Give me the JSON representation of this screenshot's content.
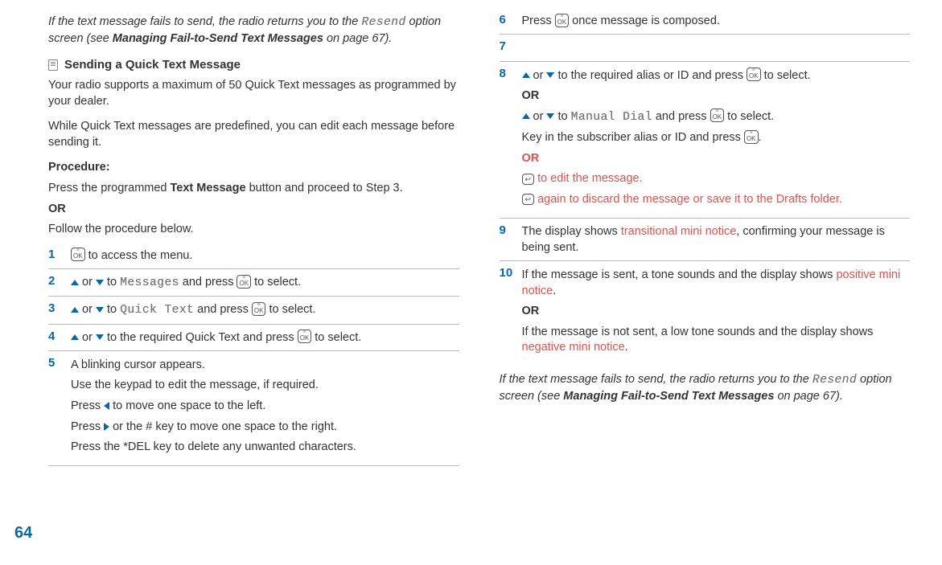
{
  "pageNumber": "64",
  "left": {
    "intro": {
      "pre": "If the text message fails to send, the radio returns you to the ",
      "mono": "Resend",
      "mid": " option screen (see ",
      "boldRef": "Managing Fail-to-Send Text Messages",
      "post": " on page 67)."
    },
    "heading": "Sending a Quick Text Message",
    "para1": "Your radio supports a maximum of 50 Quick Text messages as programmed by your dealer.",
    "para2": "While Quick Text messages are predefined, you can edit each message before sending it.",
    "procedureLabel": "Procedure:",
    "procLine1a": "Press the programmed ",
    "procLine1b": "Text Message",
    "procLine1c": " button and proceed to Step 3.",
    "or": "OR",
    "procLine2": "Follow the procedure below.",
    "steps": {
      "s1": " to access the menu.",
      "s2_or": " or ",
      "s2_to": " to ",
      "s2_menu": "Messages",
      "s2_and": " and press ",
      "s2_end": " to select.",
      "s3_menu": "Quick Text",
      "s4_txt": " to the required Quick Text and press ",
      "s5_l1": "A blinking cursor appears.",
      "s5_l2": "Use the keypad to edit the message, if required.",
      "s5_l3a": "Press ",
      "s5_l3b": " to move one space to the left.",
      "s5_l4a": "Press ",
      "s5_l4b": " or the # key to move one space to the right.",
      "s5_l5": "Press the *DEL key to delete any unwanted characters."
    }
  },
  "right": {
    "s6a": "Press ",
    "s6b": " once message is composed.",
    "s8": {
      "l1a": " or ",
      "l1b": " to the required alias or ID and press ",
      "l1c": " to select.",
      "or": "OR",
      "l2a": " or ",
      "l2b": " to ",
      "l2menu": "Manual Dial",
      "l2c": " and press ",
      "l2d": " to select.",
      "l3a": "Key in the subscriber alias or ID and press ",
      "l3b": ".",
      "or2": "OR",
      "red1": " to edit the message.",
      "red2": " again to discard the message or save it to the Drafts folder."
    },
    "s9a": "The display shows ",
    "s9red": "transitional mini notice",
    "s9b": ", confirming your message is being sent.",
    "s10a": "If the message is sent, a tone sounds and the display shows ",
    "s10red1": "positive mini notice",
    "s10b": ".",
    "s10or": "OR",
    "s10c": "If the message is not sent, a low tone sounds and the display shows ",
    "s10red2": "negative mini notice",
    "s10d": ".",
    "outro": {
      "pre": "If the text message fails to send, the radio returns you to the ",
      "mono": "Resend",
      "mid": " option screen (see ",
      "boldRef": "Managing Fail-to-Send Text Messages",
      "post": " on page 67)."
    }
  },
  "nums": {
    "n1": "1",
    "n2": "2",
    "n3": "3",
    "n4": "4",
    "n5": "5",
    "n6": "6",
    "n7": "7",
    "n8": "8",
    "n9": "9",
    "n10": "10"
  }
}
